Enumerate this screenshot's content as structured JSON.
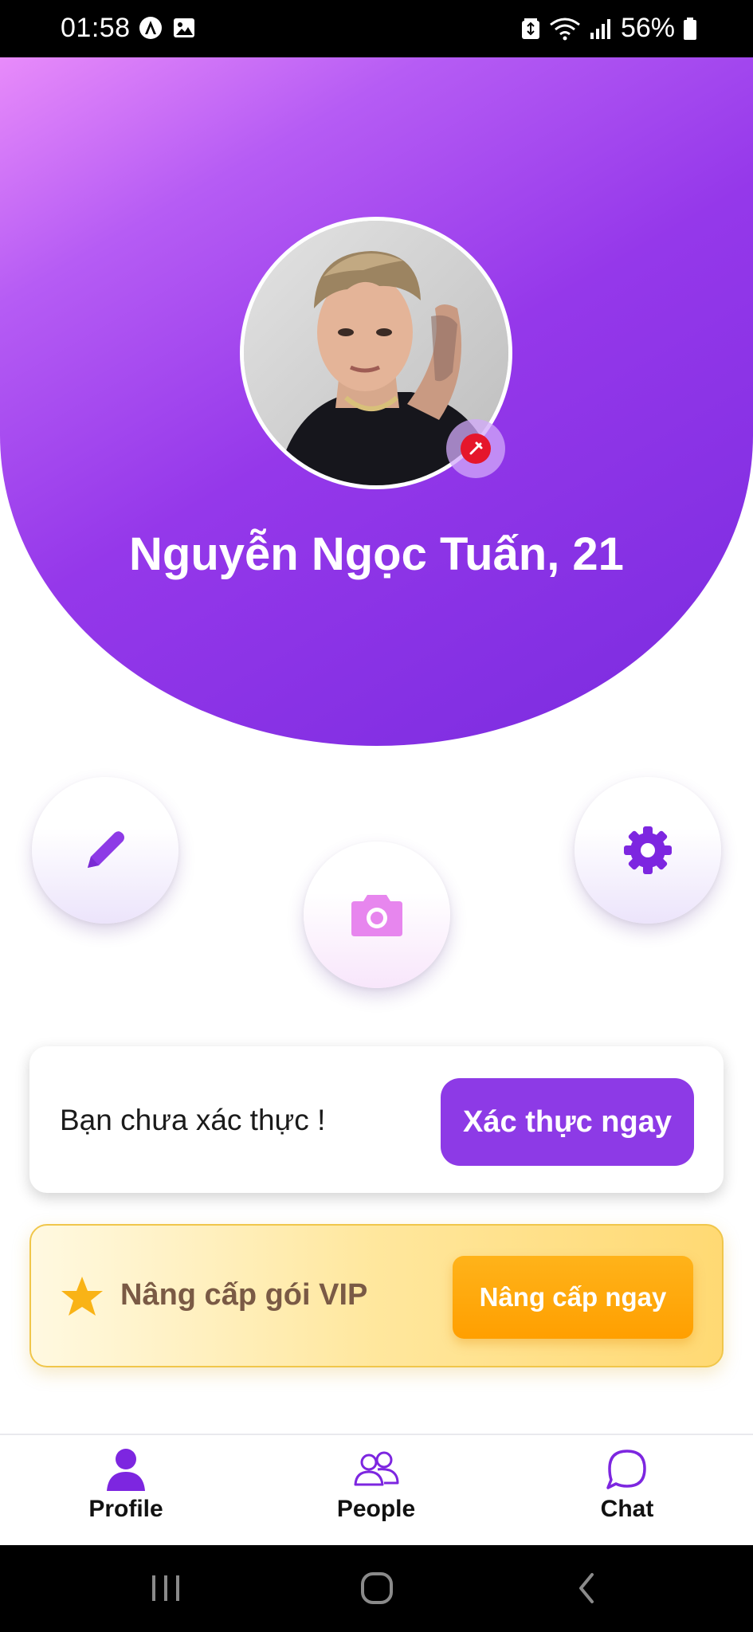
{
  "status_bar": {
    "time": "01:58",
    "battery_percent": "56%",
    "left_icons": [
      "app-a-icon",
      "gallery-icon"
    ],
    "right_icons": [
      "battery-saver-icon",
      "wifi-icon",
      "signal-icon",
      "battery-icon"
    ]
  },
  "profile": {
    "name_age": "Nguyễn Ngọc Tuấn, 21",
    "avatar_icon": "user-photo",
    "verified_badge_icon": "unverified-badge-icon"
  },
  "actions": {
    "edit_icon": "pencil-icon",
    "camera_icon": "camera-icon",
    "settings_icon": "gear-icon"
  },
  "verify_card": {
    "message": "Bạn chưa xác thực !",
    "button_label": "Xác thực ngay"
  },
  "vip_card": {
    "icon": "star-icon",
    "message": "Nâng cấp gói VIP",
    "button_label": "Nâng cấp ngay"
  },
  "bottom_nav": {
    "items": [
      {
        "label": "Profile",
        "icon": "person-icon",
        "active": true
      },
      {
        "label": "People",
        "icon": "people-icon",
        "active": false
      },
      {
        "label": "Chat",
        "icon": "chat-icon",
        "active": false
      }
    ]
  },
  "system_nav": {
    "buttons": [
      "recent-apps-icon",
      "home-icon",
      "back-icon"
    ]
  },
  "colors": {
    "primary": "#8d3ae6",
    "header_gradient_start": "#e88bfa",
    "header_gradient_end": "#7a2bdf",
    "vip_accent": "#ff9f00",
    "badge_red": "#e5162b"
  }
}
